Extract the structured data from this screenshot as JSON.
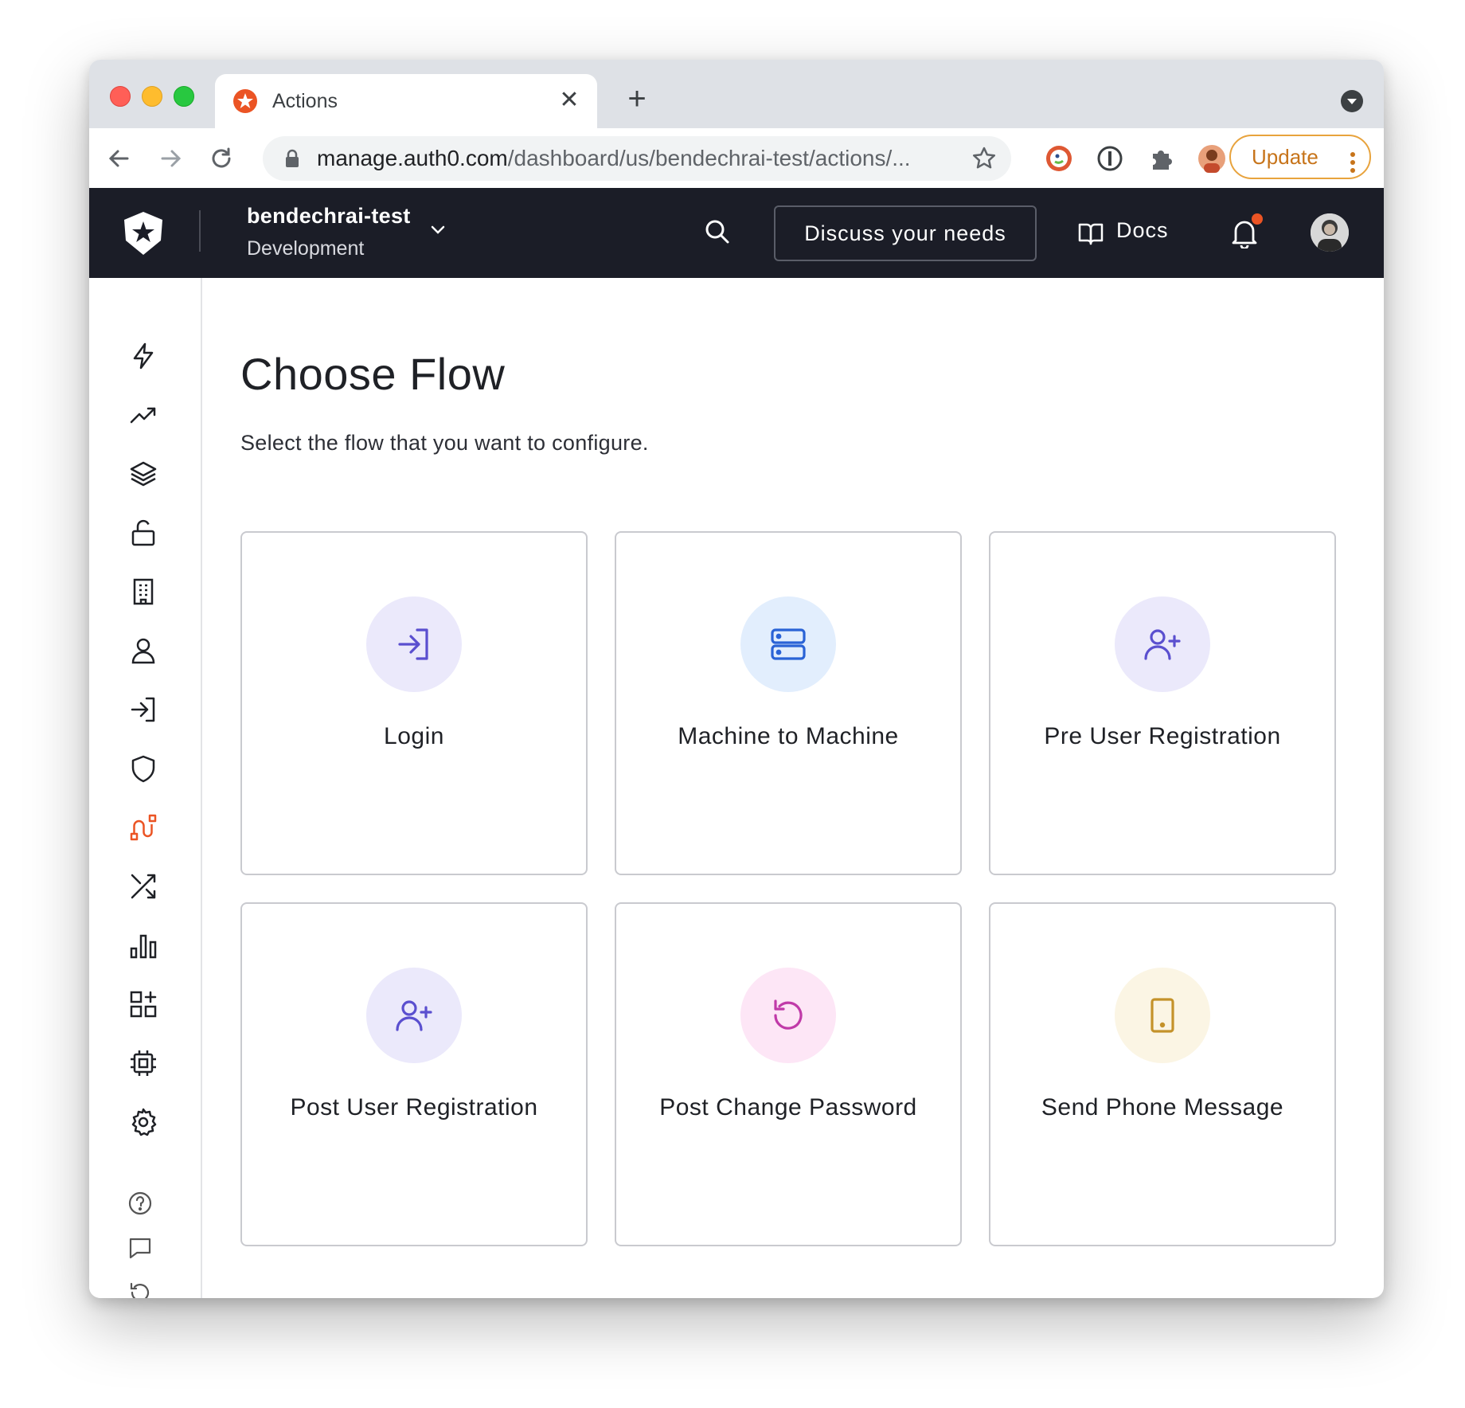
{
  "browser": {
    "tab_title": "Actions",
    "new_tab_label": "+",
    "url_host": "manage.auth0.com",
    "url_path": "/dashboard/us/bendechrai-test/actions/...",
    "update_label": "Update"
  },
  "header": {
    "tenant_name": "bendechrai-test",
    "tenant_env": "Development",
    "discuss_label": "Discuss your needs",
    "docs_label": "Docs"
  },
  "page": {
    "title": "Choose Flow",
    "subtitle": "Select the flow that you want to configure."
  },
  "flows": [
    {
      "label": "Login",
      "icon": "login-icon",
      "bg": "#ebe9fb",
      "fg": "#5a4fcf"
    },
    {
      "label": "Machine to Machine",
      "icon": "server-icon",
      "bg": "#e2eefd",
      "fg": "#2a63d6"
    },
    {
      "label": "Pre User Registration",
      "icon": "user-plus-icon",
      "bg": "#ebe9fb",
      "fg": "#5a4fcf"
    },
    {
      "label": "Post User Registration",
      "icon": "user-plus-icon",
      "bg": "#ebe9fb",
      "fg": "#5a4fcf"
    },
    {
      "label": "Post Change Password",
      "icon": "rotate-icon",
      "bg": "#fde6f6",
      "fg": "#c03aa8"
    },
    {
      "label": "Send Phone Message",
      "icon": "phone-icon",
      "bg": "#fbf5e4",
      "fg": "#c4922a"
    }
  ],
  "sidebar": {
    "items": [
      "getting-started-icon",
      "activity-icon",
      "applications-icon",
      "authentication-icon",
      "organizations-icon",
      "user-management-icon",
      "branding-icon",
      "security-icon",
      "actions-icon",
      "auth-pipeline-icon",
      "monitoring-icon",
      "marketplace-icon",
      "extensions-icon",
      "settings-icon"
    ],
    "footer": [
      "help-icon",
      "feedback-icon",
      "history-icon"
    ],
    "active_color": "#eb5424"
  }
}
